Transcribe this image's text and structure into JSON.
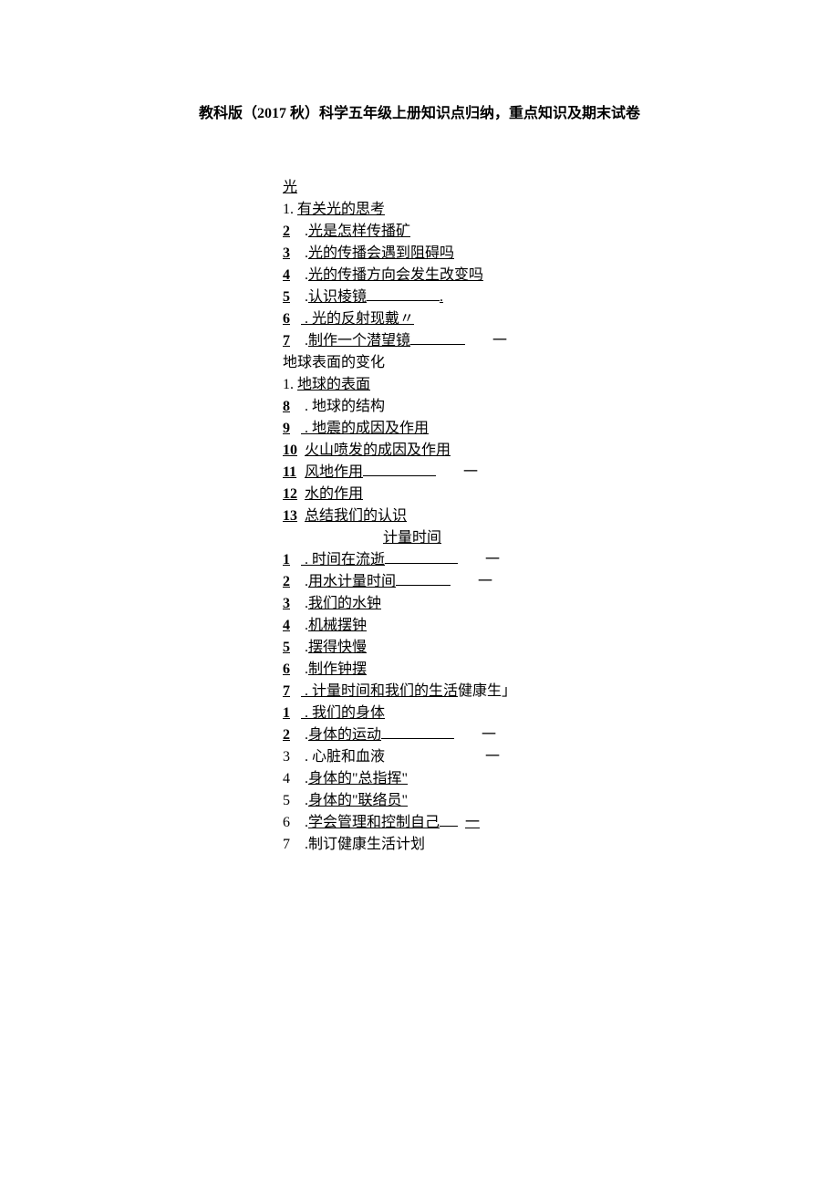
{
  "doc_title": "教科版（2017 秋）科学五年级上册知识点归纳，重点知识及期末试卷",
  "unit1": {
    "heading": "光",
    "items": [
      {
        "n": "1.",
        "t": "有关光的思考"
      },
      {
        "n": "2",
        "t": "光是怎样传播矿"
      },
      {
        "n": "3",
        "t": "光的传播会遇到阻碍吗"
      },
      {
        "n": "4",
        "t": "光的传播方向会发生改变吗"
      },
      {
        "n": "5",
        "t": "认识棱镜",
        "trail_dot": true
      },
      {
        "n": "6",
        "t": "光的反射现戴〃"
      },
      {
        "n": "7",
        "t": "制作一个潜望镜",
        "trail_one": true
      }
    ]
  },
  "unit2": {
    "heading": "地球表面的变化",
    "first": {
      "n": "1.",
      "t": "地球的表面"
    },
    "items": [
      {
        "n": "8",
        "t": "地球的结构"
      },
      {
        "n": "9",
        "t": "地震的成因及作用"
      },
      {
        "n": "10",
        "t": "火山喷发的成因及作用"
      },
      {
        "n": "11",
        "t": "风地作用",
        "trail_one": true
      },
      {
        "n": "12",
        "t": "水的作用"
      },
      {
        "n": "13",
        "t": "总结我们的认识"
      }
    ]
  },
  "unit3": {
    "heading": "计量时间",
    "items": [
      {
        "n": "1",
        "t": "时间在流逝",
        "trail_one": true
      },
      {
        "n": "2",
        "t": "用水计量时间",
        "trail_one": true
      },
      {
        "n": "3",
        "t": "我们的水钟"
      },
      {
        "n": "4",
        "t": "机械摆钟"
      },
      {
        "n": "5",
        "t": "摆得快慢"
      },
      {
        "n": "6",
        "t": "制作钟摆"
      },
      {
        "n": "7",
        "t": "计量时间和我们的生活",
        "suffix": "健康生」"
      }
    ]
  },
  "unit4": {
    "items": [
      {
        "n": "1",
        "t": "我们的身体"
      },
      {
        "n": "2",
        "t": "身体的运动",
        "trail_one": true
      },
      {
        "n": "3",
        "t": "心脏和血液",
        "trail_one_plain": true,
        "plain": true
      },
      {
        "n": "4",
        "t": "身体的\"总指挥\""
      },
      {
        "n": "5",
        "t": "身体的\"联络员\""
      },
      {
        "n": "6",
        "t": "学会管理和控制自己",
        "trail_one_short": true
      },
      {
        "n": "7",
        "t": "制订健康生活计划",
        "plain": true
      }
    ]
  },
  "labels": {
    "dot": ".",
    "period_dot": ". ",
    "one": "一"
  }
}
